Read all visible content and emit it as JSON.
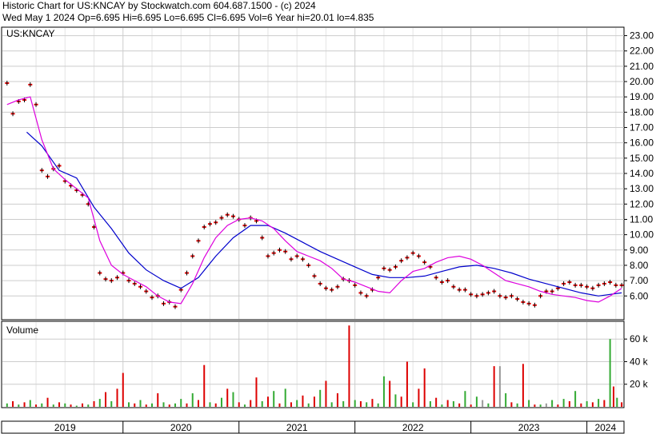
{
  "header": {
    "line1": "Historic Chart for US:KNCAY by Stockwatch.com 604.687.1500 - (c) 2024",
    "line2": "Wed May  1 2024  Op=6.695  Hi=6.695  Lo=6.695  Cl=6.695  Vol=6  Year hi=20.01  lo=4.835"
  },
  "price_panel": {
    "label": "US:KNCAY"
  },
  "volume_panel": {
    "label": "Volume"
  },
  "colors": {
    "price_marks": "#dd0000",
    "ma_short": "#dd00dd",
    "ma_long": "#0000cc",
    "vol_up": "#33aa33",
    "vol_down": "#dd0000",
    "vol_flat": "#999999",
    "grid": "#cccccc"
  },
  "chart_data": [
    {
      "type": "line",
      "title": "",
      "ylim": [
        4.5,
        23.5
      ],
      "y_ticks": [
        6,
        7,
        8,
        9,
        10,
        11,
        12,
        13,
        14,
        15,
        16,
        17,
        18,
        19,
        20,
        21,
        22,
        23
      ],
      "x_labels": [
        "2019",
        "2020",
        "2021",
        "2022",
        "2023",
        "2024"
      ],
      "grid": true,
      "series": [
        {
          "name": "",
          "role": "close",
          "x": [
            2019.0,
            2019.05,
            2019.1,
            2019.15,
            2019.2,
            2019.25,
            2019.3,
            2019.35,
            2019.4,
            2019.45,
            2019.5,
            2019.55,
            2019.6,
            2019.65,
            2019.7,
            2019.75,
            2019.8,
            2019.85,
            2019.9,
            2019.95,
            2020.0,
            2020.05,
            2020.1,
            2020.15,
            2020.2,
            2020.25,
            2020.3,
            2020.35,
            2020.4,
            2020.45,
            2020.5,
            2020.55,
            2020.6,
            2020.65,
            2020.7,
            2020.75,
            2020.8,
            2020.85,
            2020.9,
            2020.95,
            2021.0,
            2021.05,
            2021.1,
            2021.15,
            2021.2,
            2021.25,
            2021.3,
            2021.35,
            2021.4,
            2021.45,
            2021.5,
            2021.55,
            2021.6,
            2021.65,
            2021.7,
            2021.75,
            2021.8,
            2021.85,
            2021.9,
            2021.95,
            2022.0,
            2022.05,
            2022.1,
            2022.15,
            2022.2,
            2022.25,
            2022.3,
            2022.35,
            2022.4,
            2022.45,
            2022.5,
            2022.55,
            2022.6,
            2022.65,
            2022.7,
            2022.75,
            2022.8,
            2022.85,
            2022.9,
            2022.95,
            2023.0,
            2023.05,
            2023.1,
            2023.15,
            2023.2,
            2023.25,
            2023.3,
            2023.35,
            2023.4,
            2023.45,
            2023.5,
            2023.55,
            2023.6,
            2023.65,
            2023.7,
            2023.75,
            2023.8,
            2023.85,
            2023.9,
            2023.95,
            2024.0,
            2024.05,
            2024.1,
            2024.15,
            2024.2,
            2024.25,
            2024.3
          ],
          "values": [
            19.9,
            17.9,
            18.7,
            18.8,
            19.8,
            18.5,
            14.2,
            13.8,
            14.3,
            14.5,
            13.5,
            13.2,
            12.9,
            12.6,
            12.0,
            10.5,
            7.5,
            7.1,
            7.0,
            7.2,
            7.5,
            7.0,
            6.8,
            6.6,
            6.3,
            5.9,
            6.0,
            5.5,
            5.6,
            5.3,
            6.4,
            7.5,
            8.6,
            9.6,
            10.5,
            10.7,
            10.8,
            11.1,
            11.3,
            11.2,
            11.0,
            10.6,
            11.1,
            10.9,
            9.8,
            8.6,
            8.8,
            9.0,
            8.9,
            8.4,
            8.6,
            8.4,
            8.0,
            7.3,
            6.8,
            6.5,
            6.4,
            6.6,
            7.1,
            7.0,
            6.7,
            6.2,
            6.0,
            6.4,
            7.2,
            7.8,
            7.7,
            7.9,
            8.3,
            8.5,
            8.8,
            8.6,
            8.2,
            7.9,
            7.2,
            6.9,
            7.0,
            6.6,
            6.4,
            6.4,
            6.1,
            6.0,
            6.1,
            6.2,
            6.3,
            6.0,
            5.9,
            6.0,
            5.8,
            5.6,
            5.5,
            5.4,
            6.0,
            6.3,
            6.3,
            6.5,
            6.8,
            6.9,
            6.7,
            6.7,
            6.6,
            6.5,
            6.7,
            6.8,
            6.9,
            6.7,
            6.7
          ]
        },
        {
          "name": "",
          "role": "short_ma",
          "x": [
            2019.0,
            2019.1,
            2019.2,
            2019.3,
            2019.4,
            2019.5,
            2019.6,
            2019.7,
            2019.8,
            2019.9,
            2020.0,
            2020.1,
            2020.2,
            2020.3,
            2020.4,
            2020.5,
            2020.6,
            2020.7,
            2020.8,
            2020.9,
            2021.0,
            2021.1,
            2021.2,
            2021.3,
            2021.4,
            2021.5,
            2021.6,
            2021.7,
            2021.8,
            2021.9,
            2022.0,
            2022.1,
            2022.2,
            2022.3,
            2022.4,
            2022.5,
            2022.6,
            2022.7,
            2022.8,
            2022.9,
            2023.0,
            2023.1,
            2023.2,
            2023.3,
            2023.4,
            2023.5,
            2023.6,
            2023.7,
            2023.8,
            2023.9,
            2024.0,
            2024.1,
            2024.2,
            2024.3
          ],
          "values": [
            18.5,
            18.8,
            19.0,
            16.2,
            14.3,
            13.6,
            13.0,
            12.4,
            9.6,
            8.0,
            7.4,
            7.0,
            6.6,
            6.0,
            5.6,
            5.5,
            6.8,
            8.5,
            9.8,
            10.6,
            11.0,
            11.1,
            10.9,
            10.4,
            9.6,
            8.9,
            8.6,
            8.3,
            7.8,
            7.1,
            6.9,
            6.6,
            6.3,
            6.2,
            7.0,
            7.6,
            7.8,
            8.2,
            8.5,
            8.6,
            8.4,
            8.0,
            7.5,
            7.0,
            6.8,
            6.6,
            6.3,
            6.1,
            6.0,
            5.9,
            5.7,
            5.6,
            6.0,
            6.5
          ]
        },
        {
          "name": "",
          "role": "long_ma",
          "x": [
            2019.17,
            2019.3,
            2019.45,
            2019.6,
            2019.75,
            2019.9,
            2020.05,
            2020.2,
            2020.35,
            2020.5,
            2020.65,
            2020.8,
            2020.95,
            2021.1,
            2021.25,
            2021.4,
            2021.55,
            2021.7,
            2021.85,
            2022.0,
            2022.15,
            2022.3,
            2022.45,
            2022.6,
            2022.75,
            2022.9,
            2023.05,
            2023.2,
            2023.35,
            2023.5,
            2023.65,
            2023.8,
            2023.95,
            2024.1,
            2024.2,
            2024.3
          ],
          "values": [
            16.7,
            15.8,
            14.2,
            13.7,
            11.8,
            10.4,
            8.8,
            7.7,
            7.0,
            6.5,
            7.2,
            8.6,
            9.8,
            10.6,
            10.6,
            10.1,
            9.5,
            8.9,
            8.4,
            7.9,
            7.4,
            7.2,
            7.2,
            7.3,
            7.6,
            7.9,
            8.0,
            7.8,
            7.5,
            7.1,
            6.8,
            6.5,
            6.2,
            6.0,
            6.1,
            6.2
          ]
        }
      ]
    },
    {
      "type": "bar",
      "title": "",
      "ylim": [
        0,
        75000
      ],
      "y_ticks": [
        20000,
        40000,
        60000
      ],
      "y_tick_labels": [
        "20 k",
        "40 k",
        "60 k"
      ],
      "grid": true,
      "series": [
        {
          "name": "",
          "x": [
            2019.0,
            2019.05,
            2019.1,
            2019.15,
            2019.2,
            2019.25,
            2019.3,
            2019.35,
            2019.4,
            2019.45,
            2019.5,
            2019.55,
            2019.6,
            2019.65,
            2019.7,
            2019.75,
            2019.8,
            2019.85,
            2019.9,
            2019.95,
            2020.0,
            2020.05,
            2020.1,
            2020.15,
            2020.2,
            2020.25,
            2020.3,
            2020.35,
            2020.4,
            2020.45,
            2020.5,
            2020.55,
            2020.6,
            2020.65,
            2020.7,
            2020.75,
            2020.8,
            2020.85,
            2020.9,
            2020.95,
            2021.0,
            2021.05,
            2021.1,
            2021.15,
            2021.2,
            2021.25,
            2021.3,
            2021.35,
            2021.4,
            2021.45,
            2021.5,
            2021.55,
            2021.6,
            2021.65,
            2021.7,
            2021.75,
            2021.8,
            2021.85,
            2021.9,
            2021.95,
            2022.0,
            2022.05,
            2022.1,
            2022.15,
            2022.2,
            2022.25,
            2022.3,
            2022.35,
            2022.4,
            2022.45,
            2022.5,
            2022.55,
            2022.6,
            2022.65,
            2022.7,
            2022.75,
            2022.8,
            2022.85,
            2022.9,
            2022.95,
            2023.0,
            2023.05,
            2023.1,
            2023.15,
            2023.2,
            2023.25,
            2023.3,
            2023.35,
            2023.4,
            2023.45,
            2023.5,
            2023.55,
            2023.6,
            2023.65,
            2023.7,
            2023.75,
            2023.8,
            2023.85,
            2023.9,
            2023.95,
            2024.0,
            2024.05,
            2024.1,
            2024.15,
            2024.2,
            2024.23,
            2024.26,
            2024.3
          ],
          "values": [
            3000,
            5000,
            2000,
            4000,
            6000,
            2000,
            3000,
            8000,
            2000,
            4000,
            3000,
            2000,
            1000,
            3000,
            2000,
            5000,
            7000,
            13000,
            5000,
            16000,
            30000,
            4000,
            3000,
            6000,
            2000,
            3000,
            12000,
            4000,
            2000,
            3000,
            7000,
            3000,
            12000,
            6000,
            37000,
            4000,
            3000,
            8000,
            16000,
            13000,
            4000,
            2000,
            6000,
            26000,
            5000,
            9000,
            14000,
            3000,
            16000,
            4000,
            6000,
            10000,
            3000,
            9000,
            15000,
            23000,
            4000,
            12000,
            5000,
            72000,
            6000,
            5000,
            4000,
            7000,
            3000,
            27000,
            23000,
            11000,
            9000,
            40000,
            4000,
            16000,
            34000,
            5000,
            8000,
            2000,
            6000,
            5000,
            3000,
            14000,
            2000,
            9000,
            6000,
            3000,
            36000,
            36000,
            12000,
            4000,
            3000,
            38000,
            6000,
            2000,
            2000,
            3000,
            6000,
            2000,
            7000,
            5000,
            14000,
            3000,
            5000,
            4000,
            7000,
            6000,
            60000,
            18000,
            8000,
            4000
          ],
          "direction": [
            "up",
            "down",
            "up",
            "down",
            "up",
            "down",
            "up",
            "down",
            "up",
            "down",
            "up",
            "down",
            "up",
            "down",
            "up",
            "down",
            "up",
            "down",
            "up",
            "down",
            "down",
            "up",
            "down",
            "up",
            "down",
            "up",
            "down",
            "up",
            "down",
            "up",
            "up",
            "down",
            "up",
            "down",
            "down",
            "up",
            "down",
            "up",
            "down",
            "up",
            "down",
            "up",
            "down",
            "down",
            "up",
            "down",
            "up",
            "down",
            "up",
            "down",
            "up",
            "down",
            "up",
            "down",
            "up",
            "down",
            "up",
            "down",
            "up",
            "down",
            "up",
            "down",
            "up",
            "down",
            "up",
            "up",
            "down",
            "up",
            "down",
            "down",
            "up",
            "down",
            "down",
            "up",
            "down",
            "up",
            "down",
            "up",
            "down",
            "up",
            "down",
            "up",
            "flat",
            "up",
            "down",
            "flat",
            "up",
            "down",
            "up",
            "down",
            "up",
            "down",
            "up",
            "flat",
            "up",
            "down",
            "up",
            "down",
            "up",
            "down",
            "up",
            "down",
            "up",
            "down",
            "up",
            "down",
            "up",
            "down"
          ]
        }
      ]
    }
  ]
}
